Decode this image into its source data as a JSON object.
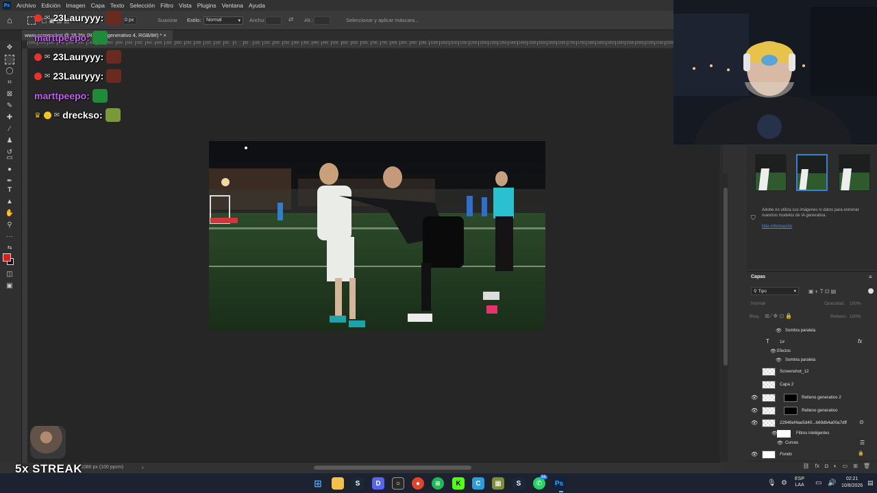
{
  "menu": {
    "items": [
      "Archivo",
      "Edición",
      "Imagen",
      "Capa",
      "Texto",
      "Selección",
      "Filtro",
      "Vista",
      "Plugins",
      "Ventana",
      "Ayuda"
    ]
  },
  "options": {
    "feather_value": "0 px",
    "smooth_label": "Suavizar",
    "style_label": "Estilo:",
    "style_value": "Normal",
    "width_label": "Anchu:",
    "height_label": "Alt.:",
    "mask_button": "Seleccionar y aplicar máscara..."
  },
  "document": {
    "tab_title": "www-screenshot @ 28,3% (Relleno generativo 4, RGB/8#) *"
  },
  "ruler_ticks": [
    "1050",
    "1000",
    "950",
    "900",
    "850",
    "800",
    "750",
    "700",
    "650",
    "600",
    "550",
    "500",
    "450",
    "400",
    "350",
    "300",
    "250",
    "200",
    "150",
    "100",
    "50",
    "0",
    "50",
    "100",
    "150",
    "200",
    "250",
    "300",
    "350",
    "400",
    "450",
    "500",
    "550",
    "600",
    "650",
    "700",
    "750",
    "800",
    "850",
    "900",
    "950",
    "1000",
    "1050",
    "1100",
    "1150",
    "1200",
    "1250",
    "1300",
    "1350",
    "1400",
    "1450",
    "1500",
    "1550",
    "1600",
    "1650",
    "1700",
    "1750",
    "1800",
    "1850",
    "1900",
    "1950",
    "2000",
    "2050",
    "2100",
    "2150",
    "2200",
    "2250",
    "2300",
    "2350",
    "2400",
    "2450"
  ],
  "status": {
    "doc_info": "1080 px (100 ppcm)"
  },
  "ai_panel": {
    "note": "Adobe no utiliza sus imágenes ni datos para entrenar nuestros modelos de IA generativa.",
    "link": "Más información"
  },
  "layers_panel": {
    "tab": "Capas",
    "filter": "Tipo",
    "blend": "Normal",
    "opacity_label": "Opacidad:",
    "opacity_value": "100%",
    "lock_label": "Bloq.:",
    "fill_label": "Relleno:",
    "fill_value": "100%",
    "rows": [
      {
        "name": "Sombra paralela"
      },
      {
        "name": "1#"
      },
      {
        "name": "Efectos"
      },
      {
        "name": "Sombra paralela"
      },
      {
        "name": "Screenshot_12"
      },
      {
        "name": "Capa 2"
      },
      {
        "name": "Relleno generativo 2"
      },
      {
        "name": "Relleno generativo"
      },
      {
        "name": "22946ef4ae5d40...b69db4a00a7dff"
      },
      {
        "name": "Filtros inteligentes"
      },
      {
        "name": "Curvas"
      },
      {
        "name": "Fondo"
      }
    ]
  },
  "chat": {
    "lines": [
      {
        "user": "23Lauryyy:",
        "color": "#ffffff"
      },
      {
        "user": "marttpeepo:",
        "color": "#c45cf2"
      },
      {
        "user": "23Lauryyy:",
        "color": "#ffffff"
      },
      {
        "user": "23Lauryyy:",
        "color": "#ffffff"
      },
      {
        "user": "marttpeepo:",
        "color": "#c45cf2"
      },
      {
        "user": "dreckso:",
        "color": "#ffffff"
      }
    ]
  },
  "overlay": {
    "streak": "5x STREAK"
  },
  "taskbar": {
    "lang_top": "ESP",
    "lang_bottom": "LAA",
    "time": "02:21",
    "date": "10/8/2026",
    "whatsapp_badge": "56"
  },
  "colors": {
    "foreground": "#e41b1b",
    "background": "#111111",
    "accent_blue": "#3a7fd8"
  }
}
